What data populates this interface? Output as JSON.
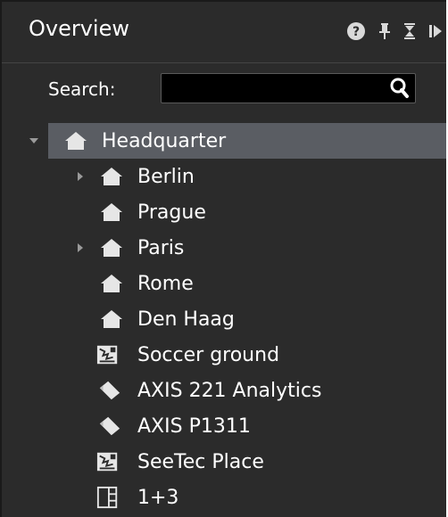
{
  "panel": {
    "title": "Overview",
    "toolbar_icons": [
      "help-icon",
      "pin-icon",
      "collapse-icon",
      "dock-icon"
    ]
  },
  "search": {
    "label": "Search:",
    "value": "",
    "placeholder": ""
  },
  "tree": {
    "items": [
      {
        "label": "Headquarter",
        "icon": "home-icon",
        "expanded": true
      },
      {
        "label": "Berlin",
        "icon": "home-icon",
        "expandable": true
      },
      {
        "label": "Prague",
        "icon": "home-icon"
      },
      {
        "label": "Paris",
        "icon": "home-icon",
        "expandable": true
      },
      {
        "label": "Rome",
        "icon": "home-icon"
      },
      {
        "label": "Den Haag",
        "icon": "home-icon"
      },
      {
        "label": "Soccer ground",
        "icon": "map-icon"
      },
      {
        "label": "AXIS 221 Analytics",
        "icon": "camera-icon"
      },
      {
        "label": "AXIS P1311",
        "icon": "camera-icon"
      },
      {
        "label": "SeeTec Place",
        "icon": "map-icon"
      },
      {
        "label": "1+3",
        "icon": "layout-icon"
      }
    ]
  },
  "colors": {
    "panel_bg": "#2b2b2b",
    "selected_bg": "#5a5d63",
    "search_bg": "#000000",
    "text": "#ffffff"
  }
}
